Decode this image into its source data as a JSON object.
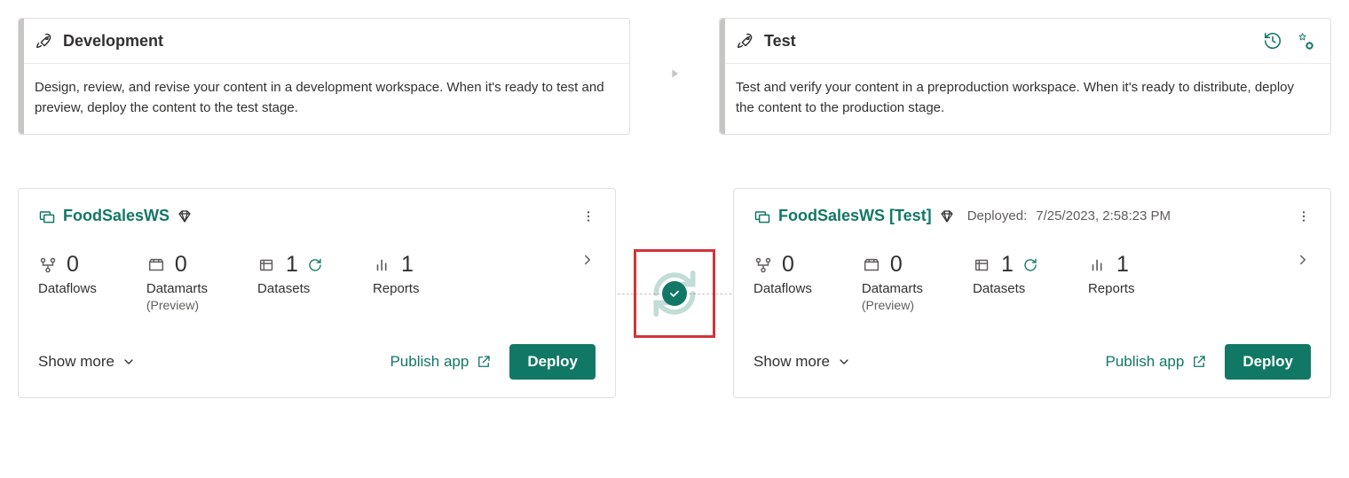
{
  "stages": {
    "dev": {
      "title": "Development",
      "desc": "Design, review, and revise your content in a development workspace. When it's ready to test and preview, deploy the content to the test stage."
    },
    "test": {
      "title": "Test",
      "desc": "Test and verify your content in a preproduction workspace. When it's ready to distribute, deploy the content to the production stage."
    }
  },
  "workspaces": {
    "dev": {
      "name": "FoodSalesWS",
      "deployed": "",
      "stats": {
        "dataflows": {
          "count": "0",
          "label": "Dataflows"
        },
        "datamarts": {
          "count": "0",
          "label": "Datamarts",
          "sub": "(Preview)"
        },
        "datasets": {
          "count": "1",
          "label": "Datasets"
        },
        "reports": {
          "count": "1",
          "label": "Reports"
        }
      }
    },
    "test": {
      "name": "FoodSalesWS [Test]",
      "deployed_label": "Deployed:",
      "deployed": "7/25/2023, 2:58:23 PM",
      "stats": {
        "dataflows": {
          "count": "0",
          "label": "Dataflows"
        },
        "datamarts": {
          "count": "0",
          "label": "Datamarts",
          "sub": "(Preview)"
        },
        "datasets": {
          "count": "1",
          "label": "Datasets"
        },
        "reports": {
          "count": "1",
          "label": "Reports"
        }
      }
    }
  },
  "actions": {
    "show_more": "Show more",
    "publish": "Publish app",
    "deploy": "Deploy"
  }
}
